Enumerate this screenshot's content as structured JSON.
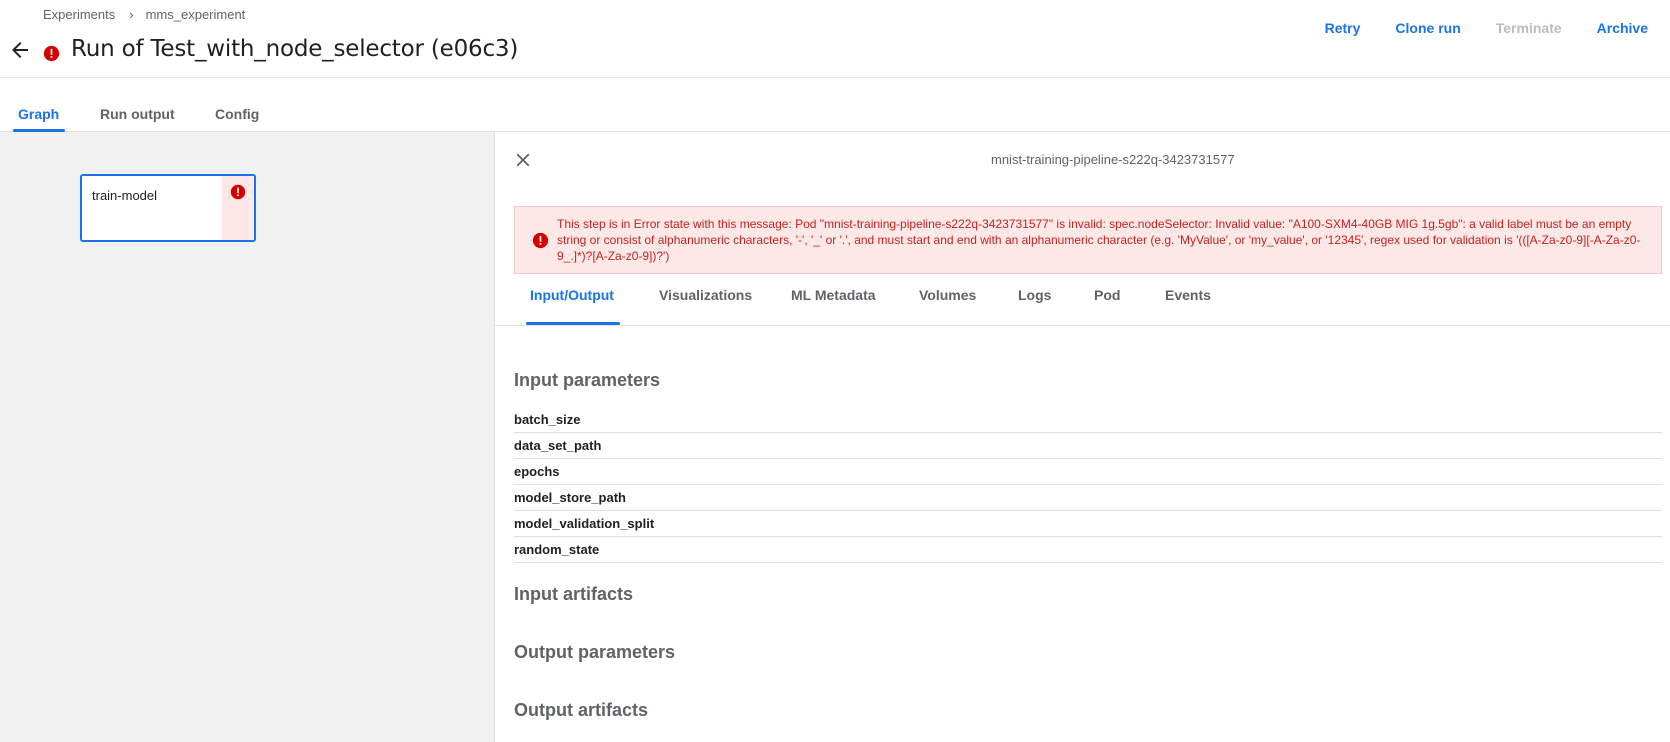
{
  "breadcrumb": {
    "items": [
      "Experiments",
      "mms_experiment"
    ],
    "separator": "›"
  },
  "header": {
    "title": "Run of Test_with_node_selector (e06c3)",
    "actions": {
      "retry": "Retry",
      "clone": "Clone run",
      "terminate": "Terminate",
      "archive": "Archive"
    }
  },
  "tabs": {
    "graph": "Graph",
    "run_output": "Run output",
    "config": "Config",
    "active": "Graph"
  },
  "graph": {
    "node": {
      "label": "train-model",
      "status": "error"
    }
  },
  "panel": {
    "node_id": "mnist-training-pipeline-s222q-3423731577",
    "error_message": "This step is in Error state with this message: Pod \"mnist-training-pipeline-s222q-3423731577\" is invalid: spec.nodeSelector: Invalid value: \"A100-SXM4-40GB MIG 1g.5gb\": a valid label must be an empty string or consist of alphanumeric characters, '-', '_' or '.', and must start and end with an alphanumeric character (e.g. 'MyValue', or 'my_value', or '12345', regex used for validation is '(([A-Za-z0-9][-A-Za-z0-9_.]*)?[A-Za-z0-9])?')",
    "tabs": {
      "input_output": "Input/Output",
      "visualizations": "Visualizations",
      "ml_metadata": "ML Metadata",
      "volumes": "Volumes",
      "logs": "Logs",
      "pod": "Pod",
      "events": "Events",
      "active": "Input/Output"
    },
    "sections": {
      "input_parameters": "Input parameters",
      "input_artifacts": "Input artifacts",
      "output_parameters": "Output parameters",
      "output_artifacts": "Output artifacts"
    },
    "input_params": [
      "batch_size",
      "data_set_path",
      "epochs",
      "model_store_path",
      "model_validation_split",
      "random_state"
    ]
  },
  "colors": {
    "accent": "#1a73e8",
    "error": "#d50000",
    "error_bg": "#fce8e6",
    "disabled": "#bdbdbd"
  }
}
